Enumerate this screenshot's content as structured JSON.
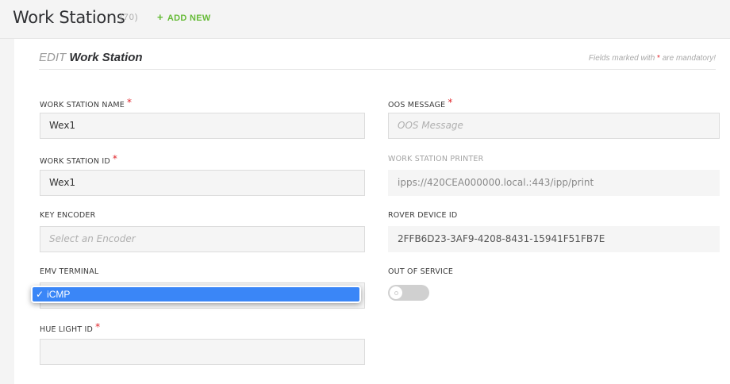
{
  "header": {
    "title": "Work Stations",
    "count": "(70)",
    "add_new_label": "ADD NEW",
    "add_new_icon": "plus-icon"
  },
  "form": {
    "title_prefix": "EDIT",
    "title_main": "Work Station",
    "mandatory_note_before": "Fields marked with",
    "mandatory_note_star": "*",
    "mandatory_note_after": "are mandatory!"
  },
  "fields": {
    "work_station_name": {
      "label": "WORK STATION NAME",
      "required": "*",
      "value": "Wex1"
    },
    "oos_message": {
      "label": "OOS MESSAGE",
      "required": "*",
      "value": "",
      "placeholder": "OOS Message"
    },
    "work_station_id": {
      "label": "WORK STATION ID",
      "required": "*",
      "value": "Wex1"
    },
    "work_station_printer": {
      "label": "WORK STATION PRINTER",
      "value": "ipps://420CEA000000.local.:443/ipp/print"
    },
    "key_encoder": {
      "label": "KEY ENCODER",
      "value": "",
      "placeholder": "Select an Encoder"
    },
    "rover_device_id": {
      "label": "ROVER DEVICE ID",
      "value": "2FFB6D23-3AF9-4208-8431-15941F51FB7E"
    },
    "emv_terminal": {
      "label": "EMV TERMINAL",
      "selected": "iCMP",
      "check": "✓"
    },
    "out_of_service": {
      "label": "OUT OF SERVICE",
      "on": false
    },
    "hue_light_id": {
      "label": "HUE LIGHT ID",
      "required": "*",
      "value": ""
    }
  },
  "colors": {
    "accent_green": "#66bb37",
    "required_red": "#e0252b",
    "dropdown_selection": "#3a86f7"
  }
}
